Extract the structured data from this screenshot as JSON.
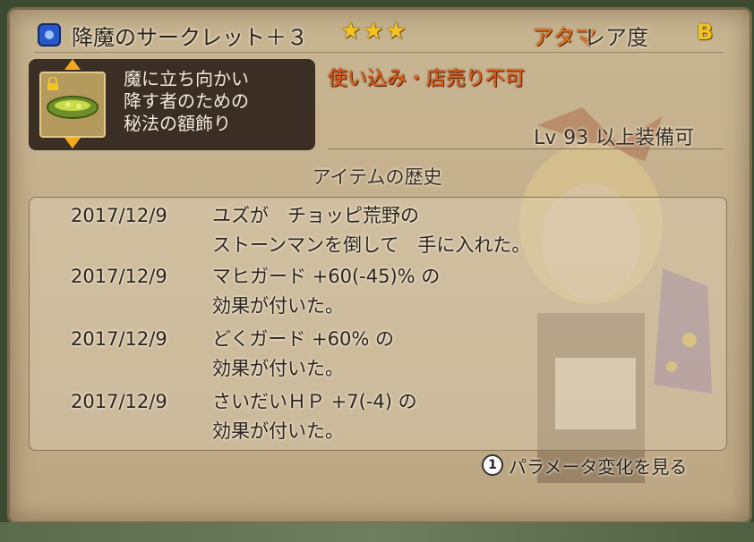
{
  "item": {
    "name": "降魔のサークレット＋３",
    "stars": "★★★",
    "slot": "アタマ",
    "rarity_label": "レア度",
    "rarity_grade": "B",
    "description": "魔に立ち向かい\n降す者のための\n秘法の額飾り",
    "restriction": "使い込み・店売り不可",
    "level_prefix": "Lv",
    "level_value": "93",
    "level_suffix": "以上装備可"
  },
  "history": {
    "title": "アイテムの歴史",
    "entries": [
      {
        "date": "2017/12/9",
        "text": "ユズが　チョッピ荒野の\nストーンマンを倒して　手に入れた。"
      },
      {
        "date": "2017/12/9",
        "text": "マヒガード +60(-45)% の\n効果が付いた。"
      },
      {
        "date": "2017/12/9",
        "text": "どくガード +60% の\n効果が付いた。"
      },
      {
        "date": "2017/12/9",
        "text": "さいだいＨＰ +7(-4) の\n効果が付いた。"
      }
    ]
  },
  "footer": {
    "button_key": "1",
    "hint": "パラメータ変化を見る"
  },
  "colors": {
    "panel_bg": "#c8b592",
    "slot_orange": "#e8701a",
    "star_gold": "#f3c322",
    "restriction_red": "#e25a1a",
    "icon_box_dark": "#3a2e25"
  },
  "icons": {
    "item_category": "helmet-category-icon",
    "item_thumbnail": "circlet-icon",
    "lock": "lock-icon",
    "scroll_up": "arrow-up-icon",
    "scroll_down": "arrow-down-icon"
  }
}
